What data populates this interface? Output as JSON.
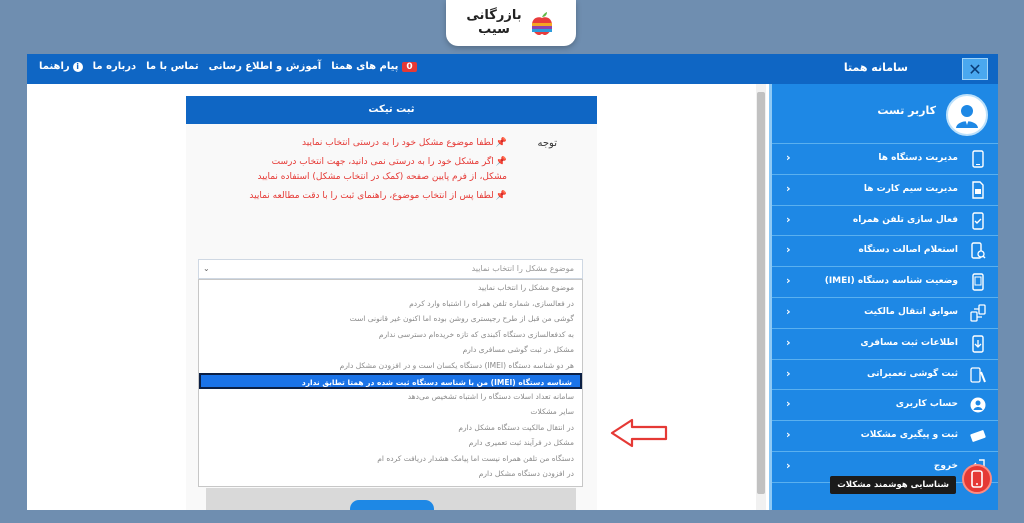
{
  "logo": {
    "line1": "بازرگانی",
    "line2": "سیب"
  },
  "topbar": {
    "app_title": "سامانه همتا",
    "close_glyph": "✕",
    "nav": {
      "messages_badge": "0",
      "messages": "پیام های همتا",
      "education": "آموزش و اطلاع رسانی",
      "contact": "تماس با ما",
      "about": "درباره ما",
      "guide": "راهنما"
    }
  },
  "sidebar": {
    "user_name": "کاربر تست",
    "items": [
      {
        "label": "مدیریت دستگاه ها",
        "icon": "devices-icon"
      },
      {
        "label": "مدیریت سیم کارت ها",
        "icon": "sim-card-icon"
      },
      {
        "label": "فعال سازی تلفن همراه",
        "icon": "phone-activate-icon"
      },
      {
        "label": "استعلام اصالت دستگاه",
        "icon": "phone-search-icon"
      },
      {
        "label": "وضعیت شناسه دستگاه (IMEI)",
        "icon": "imei-icon"
      },
      {
        "label": "سوابق انتقال مالکیت",
        "icon": "transfer-icon"
      },
      {
        "label": "اطلاعات ثبت مسافری",
        "icon": "passenger-icon"
      },
      {
        "label": "ثبت گوشی تعمیراتی",
        "icon": "repair-icon"
      },
      {
        "label": "حساب کاربری",
        "icon": "account-icon"
      },
      {
        "label": "ثبت و پیگیری مشکلات",
        "icon": "ticket-icon"
      },
      {
        "label": "خروج",
        "icon": "logout-icon"
      }
    ]
  },
  "panel": {
    "title": "ثبت تیکت",
    "notes_label": "توجه",
    "notes": [
      "لطفا موضوع مشکل خود را به درستی انتخاب نمایید",
      "اگر مشکل خود را به درستی نمی دانید، جهت انتخاب درست مشکل، از فرم پایین صفحه (کمک در انتخاب مشکل) استفاده نمایید",
      "لطفا پس از انتخاب موضوع، راهنمای ثبت را با دقت مطالعه نمایید"
    ],
    "select_placeholder": "موضوع مشکل را انتخاب نمایید",
    "options": [
      "موضوع مشکل را انتخاب نمایید",
      "در فعالسازی، شماره تلفن همراه را اشتباه وارد کردم",
      "گوشی من قبل از طرح رجیستری روشن بوده اما اکنون غیر قانونی است",
      "به کدفعالسازی دستگاه آکبندی که تازه خریده‌ام دسترسی ندارم",
      "مشکل در ثبت گوشی مسافری دارم",
      "هر دو شناسه دستگاه (IMEI) دستگاه یکسان است و در افزودن مشکل دارم",
      "شناسه دستگاه (IMEI) من با شناسه دستگاه ثبت شده در همتا تطابق ندارد",
      "سامانه تعداد اسلات دستگاه را اشتباه تشخیص می‌دهد",
      "سایر مشکلات",
      "در انتقال مالکیت دستگاه مشکل دارم",
      "مشکل در فرآیند ثبت تعمیری دارم",
      "دستگاه من تلفن همراه نیست اما پیامک هشدار دریافت کرده ام",
      "در افزودن دستگاه مشکل دارم"
    ],
    "selected_index": 6
  },
  "smart_help": "شناسایی هوشمند مشکلات",
  "colors": {
    "primary": "#0f66c4",
    "sidebar": "#1e88e5",
    "warning": "#e53935",
    "background": "#6f8eb0"
  }
}
